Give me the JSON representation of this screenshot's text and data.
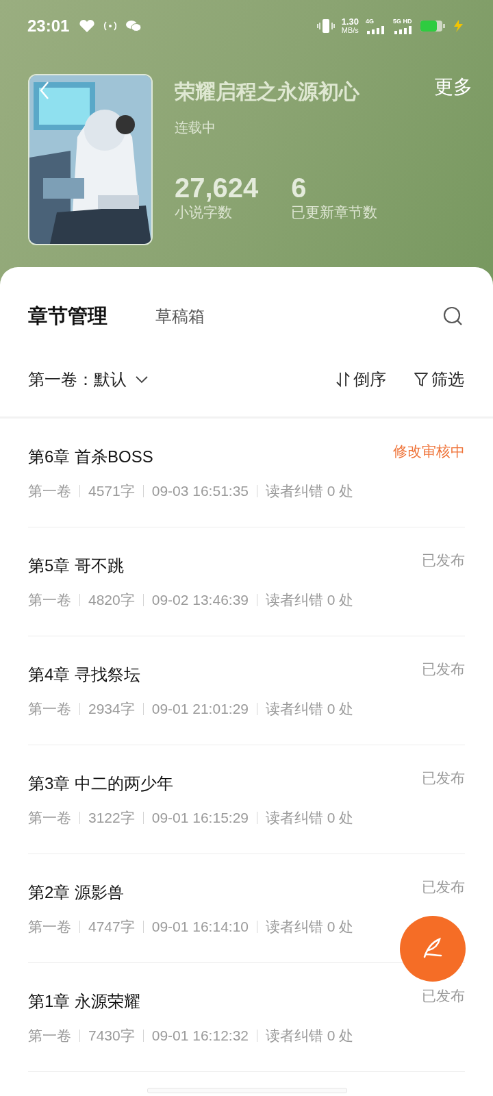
{
  "status_bar": {
    "time": "23:01",
    "speed": "1.30",
    "speed_unit": "MB/s",
    "network_1": "4G",
    "network_2": "5G HD"
  },
  "book": {
    "title": "荣耀启程之永源初心",
    "status": "连载中",
    "more": "更多",
    "stats": [
      {
        "value": "27,624",
        "label": "小说字数"
      },
      {
        "value": "6",
        "label": "已更新章节数"
      }
    ]
  },
  "tabs": [
    {
      "label": "章节管理",
      "selected": true
    },
    {
      "label": "草稿箱",
      "selected": false
    }
  ],
  "toolbar": {
    "volume": "第一卷：默认",
    "sort": "倒序",
    "filter": "筛选"
  },
  "chapters": [
    {
      "title": "第6章 首杀BOSS",
      "status": "修改审核中",
      "kind": "reviewing",
      "volume": "第一卷",
      "words": "4571字",
      "time": "09-03 16:51:35",
      "errata": "读者纠错 0 处"
    },
    {
      "title": "第5章 哥不跳",
      "status": "已发布",
      "kind": "published",
      "volume": "第一卷",
      "words": "4820字",
      "time": "09-02 13:46:39",
      "errata": "读者纠错 0 处"
    },
    {
      "title": "第4章 寻找祭坛",
      "status": "已发布",
      "kind": "published",
      "volume": "第一卷",
      "words": "2934字",
      "time": "09-01 21:01:29",
      "errata": "读者纠错 0 处"
    },
    {
      "title": "第3章 中二的两少年",
      "status": "已发布",
      "kind": "published",
      "volume": "第一卷",
      "words": "3122字",
      "time": "09-01 16:15:29",
      "errata": "读者纠错 0 处"
    },
    {
      "title": "第2章 源影兽",
      "status": "已发布",
      "kind": "published",
      "volume": "第一卷",
      "words": "4747字",
      "time": "09-01 16:14:10",
      "errata": "读者纠错 0 处"
    },
    {
      "title": "第1章 永源荣耀",
      "status": "已发布",
      "kind": "published",
      "volume": "第一卷",
      "words": "7430字",
      "time": "09-01 16:12:32",
      "errata": "读者纠错 0 处"
    }
  ]
}
